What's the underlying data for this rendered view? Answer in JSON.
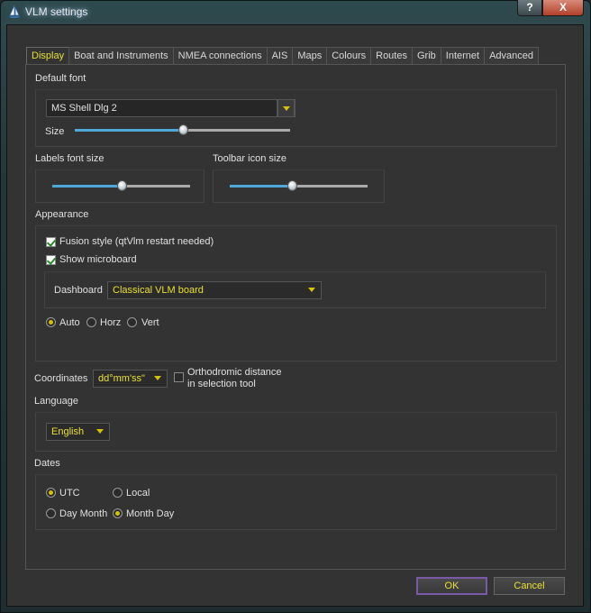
{
  "window": {
    "title": "VLM settings",
    "help_label": "?",
    "close_label": "X"
  },
  "tabs": [
    {
      "label": "Display",
      "active": true
    },
    {
      "label": "Boat and Instruments"
    },
    {
      "label": "NMEA connections"
    },
    {
      "label": "AIS"
    },
    {
      "label": "Maps"
    },
    {
      "label": "Colours"
    },
    {
      "label": "Routes"
    },
    {
      "label": "Grib"
    },
    {
      "label": "Internet"
    },
    {
      "label": "Advanced"
    }
  ],
  "default_font": {
    "section_label": "Default font",
    "font_value": "MS Shell Dlg 2",
    "size_label": "Size",
    "size_level": 0.5
  },
  "labels_font": {
    "section_label": "Labels font size",
    "level": 0.5
  },
  "toolbar_icon": {
    "section_label": "Toolbar icon size",
    "level": 0.45
  },
  "appearance": {
    "section_label": "Appearance",
    "fusion_label": "Fusion style (qtVlm restart needed)",
    "fusion_checked": true,
    "microboard_label": "Show microboard",
    "microboard_checked": true,
    "dashboard_label": "Dashboard",
    "dashboard_value": "Classical VLM board",
    "orientation": [
      {
        "label": "Auto",
        "checked": true
      },
      {
        "label": "Horz",
        "checked": false
      },
      {
        "label": "Vert",
        "checked": false
      }
    ]
  },
  "coordinates": {
    "label": "Coordinates",
    "value": "dd°mm'ss\"",
    "ortho_line1": "Orthodromic distance",
    "ortho_line2": "in selection tool",
    "ortho_checked": false
  },
  "language": {
    "section_label": "Language",
    "value": "English"
  },
  "dates": {
    "section_label": "Dates",
    "zone": [
      {
        "label": "UTC",
        "checked": true
      },
      {
        "label": "Local",
        "checked": false
      }
    ],
    "order": [
      {
        "label": "Day Month",
        "checked": false
      },
      {
        "label": "Month Day",
        "checked": true
      }
    ]
  },
  "buttons": {
    "ok_label": "OK",
    "cancel_label": "Cancel"
  },
  "colors": {
    "accent": "#e8e030",
    "slider_fill": "#4fa9d8",
    "ok_border": "#7a5aa8"
  }
}
